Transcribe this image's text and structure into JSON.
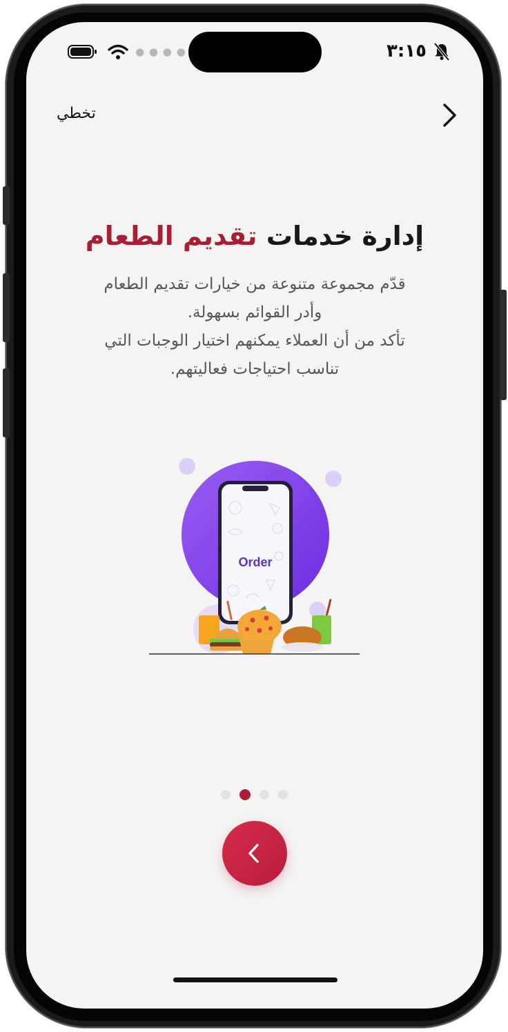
{
  "status_bar": {
    "time": "٣:١٥",
    "icons": [
      "battery-icon",
      "wifi-icon",
      "signal-dots-icon",
      "bell-mute-icon"
    ]
  },
  "header": {
    "back_icon": "chevron-right-icon",
    "skip_label": "تخطي"
  },
  "onboarding": {
    "title_part1": "إدارة خدمات",
    "title_part2": "تقديم الطعام",
    "description_lines": [
      "قدّم مجموعة متنوعة من خيارات تقديم الطعام",
      "وأدر القوائم بسهولة.",
      "تأكد من أن العملاء يمكنهم اختيار الوجبات التي",
      "تناسب احتياجات فعاليتهم."
    ],
    "illustration_label": "Order"
  },
  "pagination": {
    "total": 4,
    "active_index": 1
  },
  "next_button": {
    "icon": "chevron-left-icon"
  },
  "colors": {
    "accent": "#a81f35",
    "button_gradient_start": "#d52c4b",
    "button_gradient_end": "#b81e3a",
    "illustration_purple": "#7f3dea",
    "screen_background": "#f4f4f4"
  }
}
